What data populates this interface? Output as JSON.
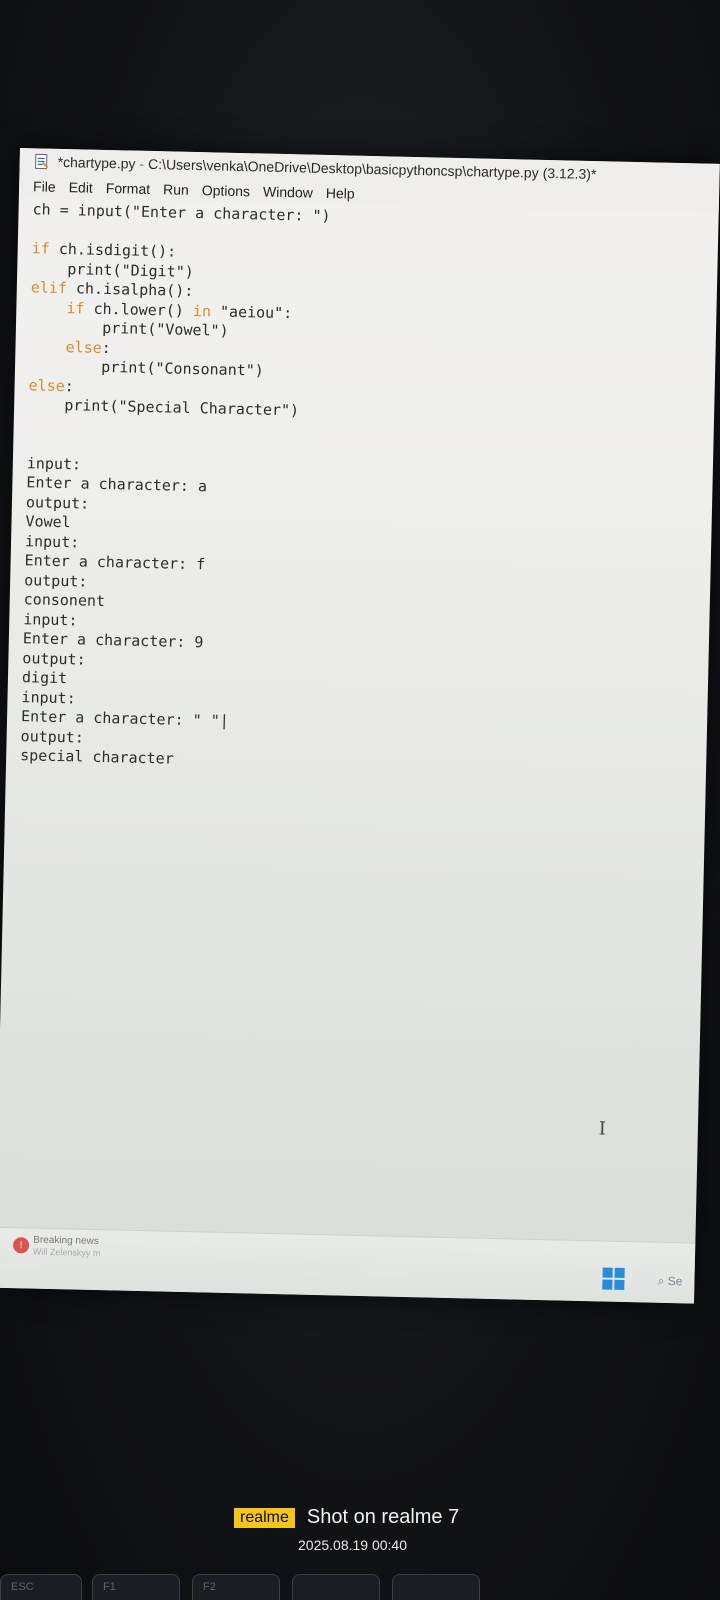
{
  "window": {
    "title_file": "*chartype.py",
    "title_sep": "-",
    "title_path": "C:\\Users\\venka\\OneDrive\\Desktop\\basicpythoncsp\\chartype.py",
    "title_version": "(3.12.3)*"
  },
  "menu": [
    "File",
    "Edit",
    "Format",
    "Run",
    "Options",
    "Window",
    "Help"
  ],
  "code_lines": [
    [
      {
        "t": "plain",
        "v": "ch = input(\"Enter a character: \")"
      }
    ],
    [],
    [
      {
        "t": "kw",
        "v": "if"
      },
      {
        "t": "plain",
        "v": " ch.isdigit():"
      }
    ],
    [
      {
        "t": "plain",
        "v": "    print(\"Digit\")"
      }
    ],
    [
      {
        "t": "kw",
        "v": "elif"
      },
      {
        "t": "plain",
        "v": " ch.isalpha():"
      }
    ],
    [
      {
        "t": "plain",
        "v": "    "
      },
      {
        "t": "kw",
        "v": "if"
      },
      {
        "t": "plain",
        "v": " ch.lower() "
      },
      {
        "t": "kw",
        "v": "in"
      },
      {
        "t": "plain",
        "v": " \"aeiou\":"
      }
    ],
    [
      {
        "t": "plain",
        "v": "        print(\"Vowel\")"
      }
    ],
    [
      {
        "t": "plain",
        "v": "    "
      },
      {
        "t": "kw",
        "v": "else"
      },
      {
        "t": "plain",
        "v": ":"
      }
    ],
    [
      {
        "t": "plain",
        "v": "        print(\"Consonant\")"
      }
    ],
    [
      {
        "t": "kw",
        "v": "else"
      },
      {
        "t": "plain",
        "v": ":"
      }
    ],
    [
      {
        "t": "plain",
        "v": "    print(\"Special Character\")"
      }
    ],
    [],
    [],
    [
      {
        "t": "plain",
        "v": "input:"
      }
    ],
    [
      {
        "t": "plain",
        "v": "Enter a character: a"
      }
    ],
    [
      {
        "t": "plain",
        "v": "output:"
      }
    ],
    [
      {
        "t": "plain",
        "v": "Vowel"
      }
    ],
    [
      {
        "t": "plain",
        "v": "input:"
      }
    ],
    [
      {
        "t": "plain",
        "v": "Enter a character: f"
      }
    ],
    [
      {
        "t": "plain",
        "v": "output:"
      }
    ],
    [
      {
        "t": "plain",
        "v": "consonent"
      }
    ],
    [
      {
        "t": "plain",
        "v": "input:"
      }
    ],
    [
      {
        "t": "plain",
        "v": "Enter a character: 9"
      }
    ],
    [
      {
        "t": "plain",
        "v": "output:"
      }
    ],
    [
      {
        "t": "plain",
        "v": "digit"
      }
    ],
    [
      {
        "t": "plain",
        "v": "input:"
      }
    ],
    [
      {
        "t": "plain",
        "v": "Enter a character: \" \"|"
      }
    ],
    [
      {
        "t": "plain",
        "v": "output:"
      }
    ],
    [
      {
        "t": "plain",
        "v": "special character"
      }
    ]
  ],
  "taskbar": {
    "news_title": "Breaking news",
    "news_sub": "Will Zelenskyy m",
    "search_hint": "Se"
  },
  "watermark": {
    "brand": "realme",
    "shot_text": "Shot on realme 7",
    "stamp": "2025.08.19 00:40"
  },
  "keyboard": {
    "esc": "ESC",
    "f1": "F1",
    "f2": "F2"
  },
  "colors": {
    "keyword": "#e08a2c",
    "string": "#2e9f3a",
    "text": "#2c2c2c",
    "brand_bg": "#f5c518"
  }
}
